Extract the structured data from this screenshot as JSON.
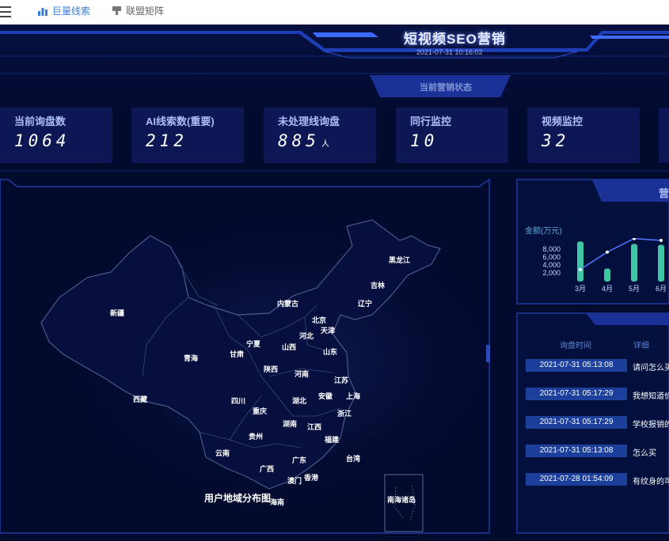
{
  "tabs": [
    {
      "label": "巨量线索",
      "icon": "bar-chart-icon"
    },
    {
      "label": "联盟矩阵",
      "icon": "pin-icon"
    }
  ],
  "header": {
    "title": "短视频SEO营销",
    "time": "2021-07-31 10:16:02",
    "status_title": "当前营销状态"
  },
  "stats": [
    {
      "label": "当前询盘数",
      "value": "1064",
      "unit": ""
    },
    {
      "label": "AI线索数(重要)",
      "value": "212",
      "unit": ""
    },
    {
      "label": "未处理线询盘",
      "value": "885",
      "unit": "人"
    },
    {
      "label": "同行监控",
      "value": "10",
      "unit": ""
    },
    {
      "label": "视频监控",
      "value": "32",
      "unit": ""
    }
  ],
  "map": {
    "title": "用户地域分布图",
    "provinces": [
      "黑龙江",
      "吉林",
      "辽宁",
      "内蒙古",
      "北京",
      "天津",
      "河北",
      "山西",
      "宁夏",
      "甘肃",
      "新疆",
      "青海",
      "西藏",
      "陕西",
      "山东",
      "河南",
      "江苏",
      "安徽",
      "上海",
      "湖北",
      "浙江",
      "四川",
      "重庆",
      "湖南",
      "江西",
      "福建",
      "贵州",
      "云南",
      "广西",
      "广东",
      "台湾",
      "香港",
      "澳门",
      "海南",
      "南海诸岛"
    ]
  },
  "chart": {
    "header_fragment": "营",
    "ylabel": "金额(万元)"
  },
  "chart_data": {
    "type": "bar",
    "categories": [
      "3月",
      "4月",
      "5月",
      "6月"
    ],
    "yticks": [
      "8,000",
      "6,000",
      "4,000",
      "2,000"
    ],
    "ylim": [
      0,
      9000
    ],
    "series": [
      {
        "values": [
          8300,
          2700,
          7800,
          7600
        ]
      },
      {
        "values": [
          2500,
          6100,
          8900,
          8500
        ]
      }
    ]
  },
  "inquiries": {
    "col_time": "询盘时间",
    "col_detail": "详细",
    "rows": [
      {
        "time": "2021-07-31 05:13:08",
        "detail": "请问怎么买"
      },
      {
        "time": "2021-07-31 05:17:29",
        "detail": "我想知道价"
      },
      {
        "time": "2021-07-31 05:17:29",
        "detail": "学校报销的"
      },
      {
        "time": "2021-07-31 05:13:08",
        "detail": "怎么买"
      },
      {
        "time": "2021-07-28 01:54:09",
        "detail": "有纹身的可"
      }
    ]
  },
  "colors": {
    "bg": "#020a2e",
    "card": "#0c1754",
    "accent": "#3d7bff",
    "bar": "#3fc7a5",
    "line": "#4a78ff"
  }
}
